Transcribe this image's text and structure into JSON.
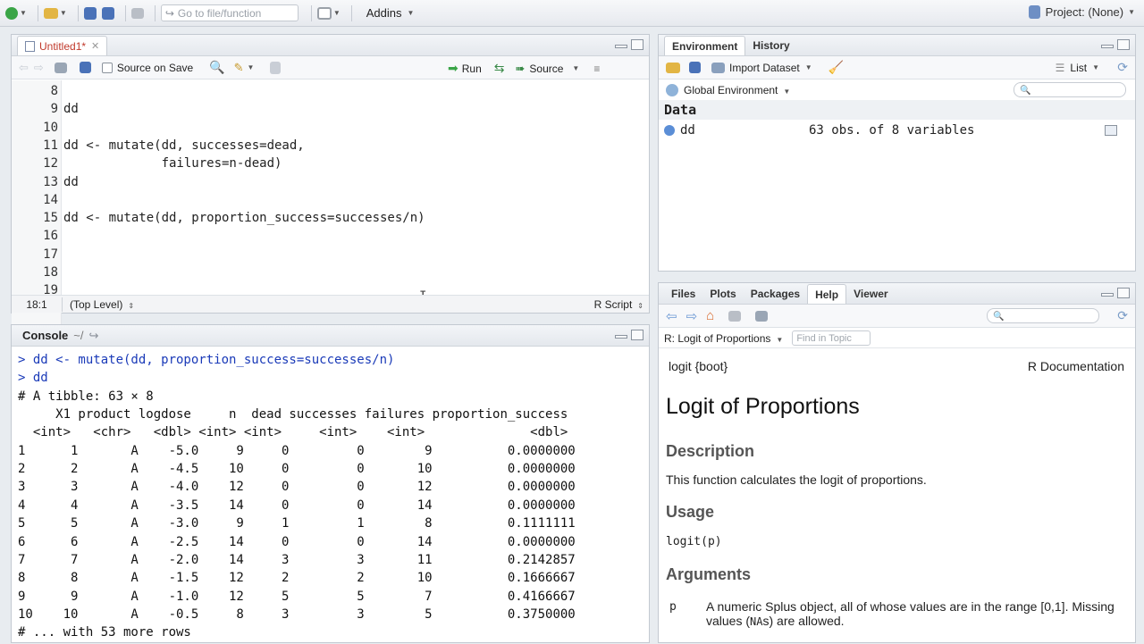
{
  "toolbar": {
    "goto_placeholder": "Go to file/function",
    "addins_label": "Addins",
    "project_label": "Project: (None)"
  },
  "editor": {
    "tab_label": "Untitled1*",
    "source_on_save_label": "Source on Save",
    "run_label": "Run",
    "source_label": "Source",
    "lines": [
      {
        "n": "8",
        "code": ""
      },
      {
        "n": "9",
        "code": "dd"
      },
      {
        "n": "10",
        "code": ""
      },
      {
        "n": "11",
        "code": "dd <- mutate(dd, successes=dead,"
      },
      {
        "n": "12",
        "code": "             failures=n-dead)"
      },
      {
        "n": "13",
        "code": "dd"
      },
      {
        "n": "14",
        "code": ""
      },
      {
        "n": "15",
        "code": "dd <- mutate(dd, proportion_success=successes/n)"
      },
      {
        "n": "16",
        "code": ""
      },
      {
        "n": "17",
        "code": ""
      },
      {
        "n": "18",
        "code": ""
      },
      {
        "n": "19",
        "code": ""
      }
    ],
    "status_position": "18:1",
    "status_scope": "(Top Level)",
    "status_filetype": "R Script"
  },
  "console": {
    "title": "Console",
    "path": "~/",
    "lines": [
      {
        "text": "> dd <- mutate(dd, proportion_success=successes/n)",
        "cmd": true
      },
      {
        "text": "> dd",
        "cmd": true
      },
      {
        "text": "# A tibble: 63 × 8",
        "cmd": false
      },
      {
        "text": "     X1 product logdose     n  dead successes failures proportion_success",
        "cmd": false
      },
      {
        "text": "  <int>   <chr>   <dbl> <int> <int>     <int>    <int>              <dbl>",
        "cmd": false
      },
      {
        "text": "1      1       A    -5.0     9     0         0        9          0.0000000",
        "cmd": false
      },
      {
        "text": "2      2       A    -4.5    10     0         0       10          0.0000000",
        "cmd": false
      },
      {
        "text": "3      3       A    -4.0    12     0         0       12          0.0000000",
        "cmd": false
      },
      {
        "text": "4      4       A    -3.5    14     0         0       14          0.0000000",
        "cmd": false
      },
      {
        "text": "5      5       A    -3.0     9     1         1        8          0.1111111",
        "cmd": false
      },
      {
        "text": "6      6       A    -2.5    14     0         0       14          0.0000000",
        "cmd": false
      },
      {
        "text": "7      7       A    -2.0    14     3         3       11          0.2142857",
        "cmd": false
      },
      {
        "text": "8      8       A    -1.5    12     2         2       10          0.1666667",
        "cmd": false
      },
      {
        "text": "9      9       A    -1.0    12     5         5        7          0.4166667",
        "cmd": false
      },
      {
        "text": "10    10       A    -0.5     8     3         3        5          0.3750000",
        "cmd": false
      },
      {
        "text": "# ... with 53 more rows",
        "cmd": false
      }
    ]
  },
  "environment": {
    "tabs": [
      "Environment",
      "History"
    ],
    "import_label": "Import Dataset",
    "view_label": "List",
    "scope_label": "Global Environment",
    "section_label": "Data",
    "rows": [
      {
        "name": "dd",
        "value": "63 obs. of 8 variables"
      }
    ]
  },
  "help": {
    "tabs": [
      "Files",
      "Plots",
      "Packages",
      "Help",
      "Viewer"
    ],
    "topic_label": "R: Logit of Proportions",
    "find_placeholder": "Find in Topic",
    "pkg_label": "logit {boot}",
    "doc_label": "R Documentation",
    "title": "Logit of Proportions",
    "description_heading": "Description",
    "description_text": "This function calculates the logit of proportions.",
    "usage_heading": "Usage",
    "usage_code": "logit(p)",
    "arguments_heading": "Arguments",
    "arg_name": "p",
    "arg_text_1": "A numeric Splus object, all of whose values are in the range [0,1]. Missing",
    "arg_text_2_pre": "values (",
    "arg_text_2_code": "NA",
    "arg_text_2_post": "s) are allowed."
  }
}
